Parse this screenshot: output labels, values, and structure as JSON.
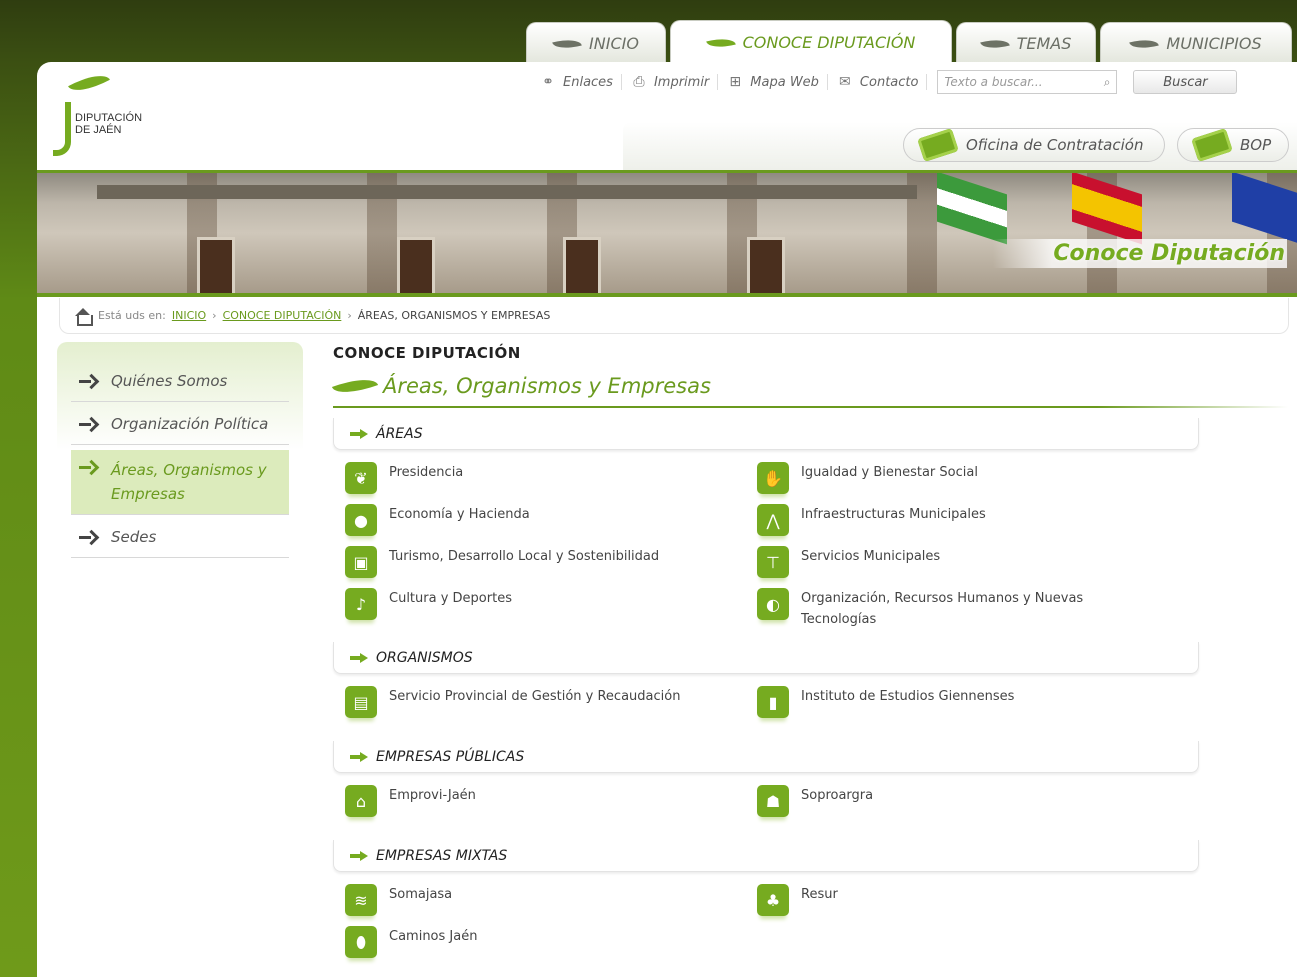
{
  "tabs": [
    {
      "label": "INICIO",
      "active": false
    },
    {
      "label": "CONOCE DIPUTACIÓN",
      "active": true
    },
    {
      "label": "TEMAS",
      "active": false
    },
    {
      "label": "MUNICIPIOS",
      "active": false
    }
  ],
  "logo": {
    "line1": "DIPUTACIÓN",
    "line2": "DE JAÉN"
  },
  "utility": {
    "enlaces": "Enlaces",
    "imprimir": "Imprimir",
    "mapa_web": "Mapa Web",
    "contacto": "Contacto",
    "search_placeholder": "Texto a buscar...",
    "search_button": "Buscar"
  },
  "shortcuts": {
    "oficina": "Oficina de Contratación",
    "bop": "BOP"
  },
  "banner": {
    "title": "Conoce Diputación"
  },
  "breadcrumb": {
    "prefix": "Está uds en:",
    "inicio": "INICIO",
    "conoce": "CONOCE DIPUTACIÓN",
    "current": "ÁREAS, ORGANISMOS Y EMPRESAS"
  },
  "sidebar": {
    "items": [
      {
        "label": "Quiénes Somos"
      },
      {
        "label": "Organización Política"
      },
      {
        "label": "Áreas, Organismos y Empresas"
      },
      {
        "label": "Sedes"
      }
    ]
  },
  "main": {
    "section": "CONOCE DIPUTACIÓN",
    "heading": "Áreas, Organismos y Empresas",
    "cat_areas": "ÁREAS",
    "cat_organismos": "ORGANISMOS",
    "cat_publicas": "EMPRESAS PÚBLICAS",
    "cat_mixtas": "EMPRESAS MIXTAS",
    "areas": {
      "presidencia": "Presidencia",
      "igualdad": "Igualdad y Bienestar Social",
      "economia": "Economía y Hacienda",
      "infraestructuras": "Infraestructuras Municipales",
      "turismo": "Turismo, Desarrollo Local y Sostenibilidad",
      "servicios": "Servicios Municipales",
      "cultura": "Cultura y Deportes",
      "organizacion": "Organización, Recursos Humanos y Nuevas Tecnologías"
    },
    "organismos": {
      "servicio": "Servicio Provincial de Gestión y Recaudación",
      "instituto": "Instituto de Estudios Giennenses"
    },
    "publicas": {
      "emprovi": "Emprovi-Jaén",
      "soproargra": "Soproargra"
    },
    "mixtas": {
      "somajasa": "Somajasa",
      "resur": "Resur",
      "caminos": "Caminos Jaén"
    }
  },
  "colors": {
    "brand_green": "#6a9a1e",
    "leaf_green": "#76ab20"
  }
}
